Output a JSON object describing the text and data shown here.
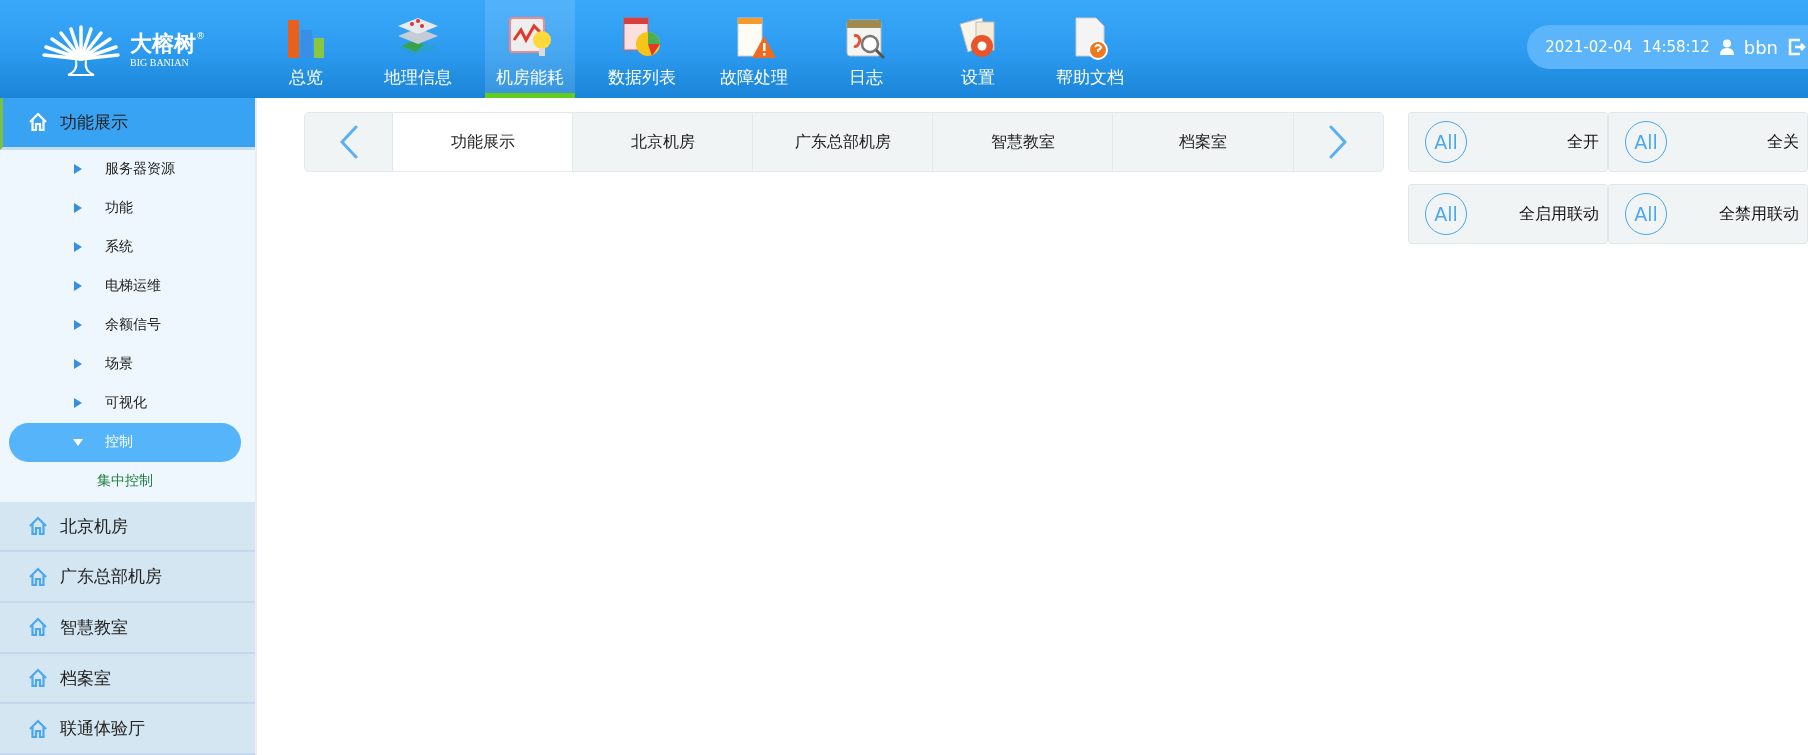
{
  "logo": {
    "name": "大榕树",
    "subtitle": "BIG BANIAN",
    "mark": "®"
  },
  "nav": [
    {
      "label": "总览",
      "selected": false
    },
    {
      "label": "地理信息",
      "selected": false
    },
    {
      "label": "机房能耗",
      "selected": true
    },
    {
      "label": "数据列表",
      "selected": false
    },
    {
      "label": "故障处理",
      "selected": false
    },
    {
      "label": "日志",
      "selected": false
    },
    {
      "label": "设置",
      "selected": false
    },
    {
      "label": "帮助文档",
      "selected": false
    }
  ],
  "user_bar": {
    "date": "2021-02-04",
    "time": "14:58:12",
    "user": "bbn"
  },
  "sidebar": {
    "groups": [
      {
        "label": "功能展示",
        "expanded": true,
        "children": [
          {
            "label": "服务器资源",
            "expanded": false,
            "selected": false
          },
          {
            "label": "功能",
            "expanded": false,
            "selected": false
          },
          {
            "label": "系统",
            "expanded": false,
            "selected": false
          },
          {
            "label": "电梯运维",
            "expanded": false,
            "selected": false
          },
          {
            "label": "余额信号",
            "expanded": false,
            "selected": false
          },
          {
            "label": "场景",
            "expanded": false,
            "selected": false
          },
          {
            "label": "可视化",
            "expanded": false,
            "selected": false
          },
          {
            "label": "控制",
            "expanded": true,
            "selected": true,
            "children": [
              {
                "label": "集中控制"
              }
            ]
          }
        ]
      },
      {
        "label": "北京机房",
        "expanded": false
      },
      {
        "label": "广东总部机房",
        "expanded": false
      },
      {
        "label": "智慧教室",
        "expanded": false
      },
      {
        "label": "档案室",
        "expanded": false
      },
      {
        "label": "联通体验厅",
        "expanded": false
      }
    ]
  },
  "tabs": [
    {
      "label": "功能展示",
      "selected": true
    },
    {
      "label": "北京机房",
      "selected": false
    },
    {
      "label": "广东总部机房",
      "selected": false
    },
    {
      "label": "智慧教室",
      "selected": false
    },
    {
      "label": "档案室",
      "selected": false
    }
  ],
  "actions": [
    {
      "badge": "All",
      "label": "全开"
    },
    {
      "badge": "All",
      "label": "全关"
    },
    {
      "badge": "All",
      "label": "全启用联动"
    },
    {
      "badge": "All",
      "label": "全禁用联动"
    }
  ]
}
